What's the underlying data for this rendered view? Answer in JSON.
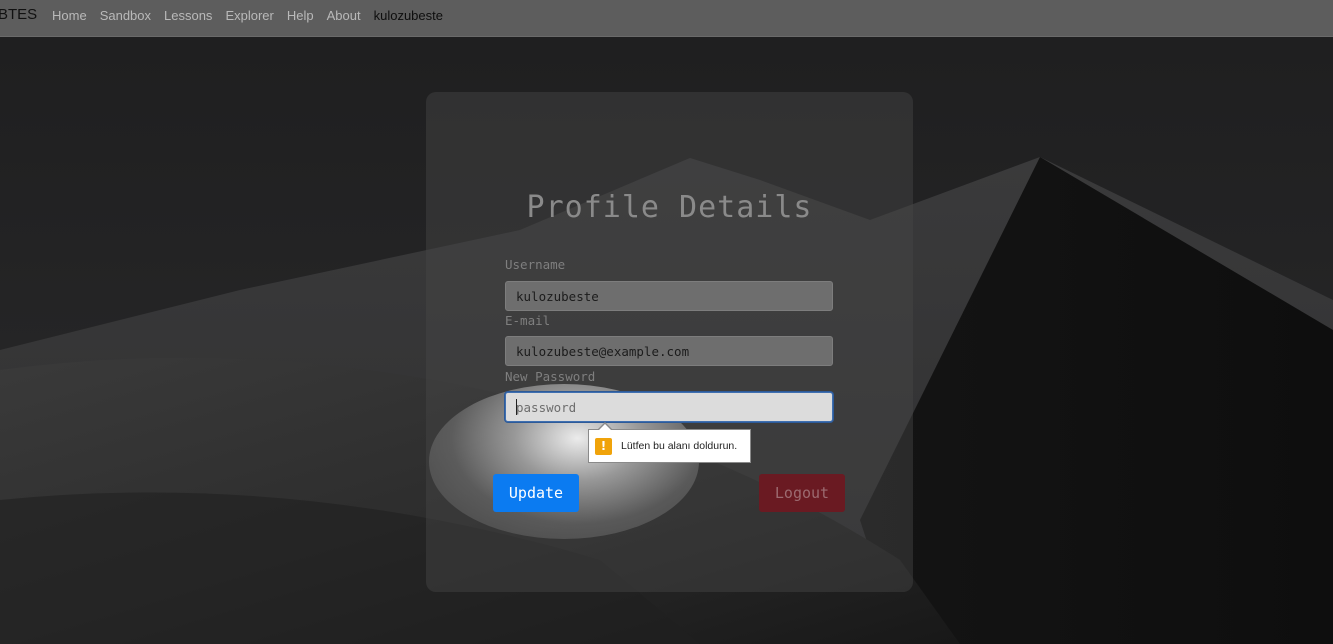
{
  "navbar": {
    "brand": "BTES",
    "links": [
      "Home",
      "Sandbox",
      "Lessons",
      "Explorer",
      "Help",
      "About"
    ],
    "user": "kulozubeste"
  },
  "form": {
    "title": "Profile Details",
    "username": {
      "label": "Username",
      "value": "kulozubeste"
    },
    "email": {
      "label": "E-mail",
      "value": "kulozubeste@example.com"
    },
    "password": {
      "label": "New Password",
      "placeholder": "password",
      "value": ""
    },
    "validation_message": "Lütfen bu alanı doldurun.",
    "update_label": "Update",
    "logout_label": "Logout"
  },
  "icons": {
    "warning": "warning-icon"
  },
  "colors": {
    "update_button": "#0b7bf1",
    "logout_button": "#6a1a22",
    "warning": "#f0a30a"
  }
}
